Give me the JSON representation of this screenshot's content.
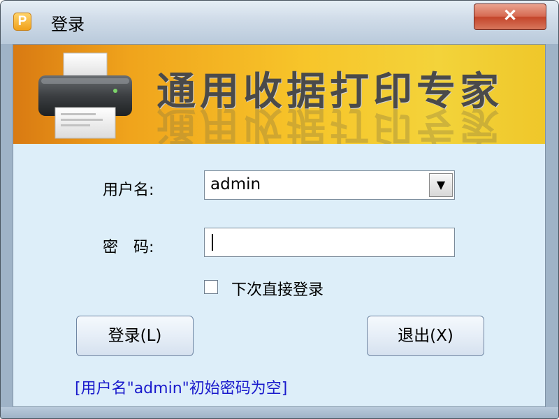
{
  "window": {
    "title": "登录",
    "app_icon_letter": "P",
    "close_symbol": "✕"
  },
  "banner": {
    "title": "通用收据打印专家"
  },
  "form": {
    "username_label": "用户名:",
    "username_value": "admin",
    "dropdown_arrow": "▼",
    "password_label": "密　码:",
    "password_value": "",
    "remember_label": "下次直接登录",
    "remember_checked": false
  },
  "buttons": {
    "login_label": "登录(L)",
    "exit_label": "退出(X)"
  },
  "hint": "[用户名\"admin\"初始密码为空]",
  "colors": {
    "content_bg": "#ddeef9",
    "hint_text": "#1a1acc",
    "close_red": "#c4452b",
    "banner_orange": "#f0a41c"
  },
  "icons": [
    "app-p-icon",
    "printer-icon",
    "close-icon",
    "chevron-down-icon"
  ]
}
